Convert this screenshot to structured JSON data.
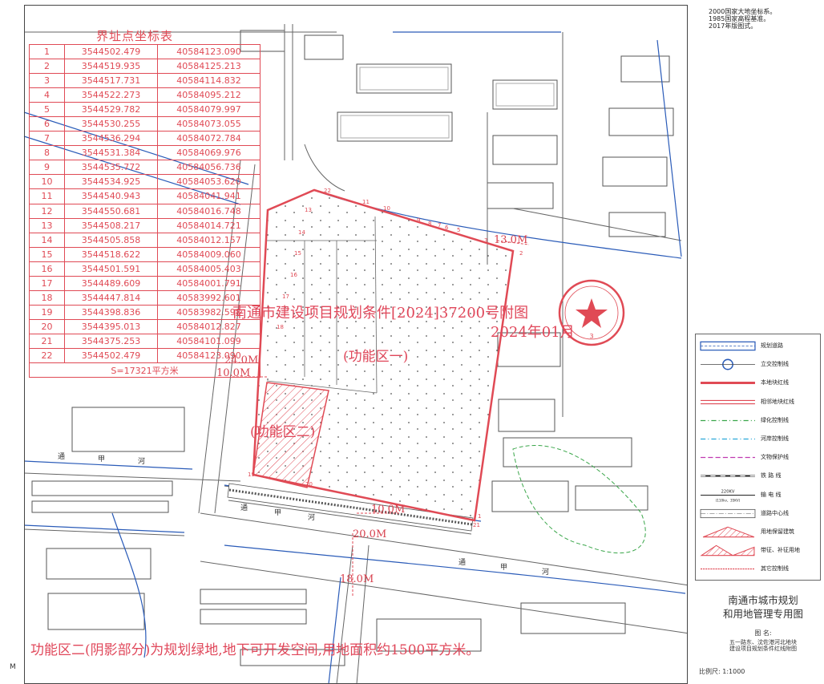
{
  "notes": [
    "2000国家大地坐标系。",
    "1985国家高程基准。",
    "2017年版图式。"
  ],
  "coord_table": {
    "title": "界址点坐标表",
    "rows": [
      [
        "1",
        "3544502.479",
        "40584123.090"
      ],
      [
        "2",
        "3544519.935",
        "40584125.213"
      ],
      [
        "3",
        "3544517.731",
        "40584114.832"
      ],
      [
        "4",
        "3544522.273",
        "40584095.212"
      ],
      [
        "5",
        "3544529.782",
        "40584079.997"
      ],
      [
        "6",
        "3544530.255",
        "40584073.055"
      ],
      [
        "7",
        "3544536.294",
        "40584072.784"
      ],
      [
        "8",
        "3544531.384",
        "40584069.976"
      ],
      [
        "9",
        "3544535.772",
        "40584056.736"
      ],
      [
        "10",
        "3544534.925",
        "40584053.620"
      ],
      [
        "11",
        "3544540.943",
        "40584041.941"
      ],
      [
        "12",
        "3544550.681",
        "40584016.748"
      ],
      [
        "13",
        "3544508.217",
        "40584014.721"
      ],
      [
        "14",
        "3544505.858",
        "40584012.157"
      ],
      [
        "15",
        "3544518.622",
        "40584009.060"
      ],
      [
        "16",
        "3544501.591",
        "40584005.403"
      ],
      [
        "17",
        "3544489.609",
        "40584001.791"
      ],
      [
        "18",
        "3544447.814",
        "40583992.601"
      ],
      [
        "19",
        "3544398.836",
        "40583982.598"
      ],
      [
        "20",
        "3544395.013",
        "40584012.827"
      ],
      [
        "21",
        "3544375.253",
        "40584101.099"
      ],
      [
        "22",
        "3544502.479",
        "40584123.090"
      ]
    ],
    "area": "S=17321平方米"
  },
  "annotations": {
    "main_title": "南通市建设项目规划条件[2024]37200号附图",
    "main_date": "2024年01月",
    "zone_one": "(功能区一)",
    "zone_two": "(功能区二)",
    "bottom_note": "功能区二(阴影部分)为规划绿地,地下可开发空间,用地面积约1500平方米。",
    "seal_number": "3"
  },
  "dimensions": [
    "13.0M",
    "24.0M",
    "10.0M",
    "10.0M",
    "20.0M",
    "18.0M"
  ],
  "parcel_points": [
    "11",
    "10",
    "9",
    "8",
    "7",
    "6",
    "5",
    "3",
    "2",
    "1",
    "13",
    "14",
    "15",
    "16",
    "17",
    "18",
    "19",
    "20",
    "21",
    "22"
  ],
  "road_labels": [
    "通",
    "甲",
    "河",
    "通",
    "甲",
    "河",
    "通",
    "甲",
    "河"
  ],
  "legend": [
    {
      "label": "规划道路",
      "symbol": "road"
    },
    {
      "label": "立交控制线",
      "symbol": "circle"
    },
    {
      "label": "本地块红线",
      "symbol": "red-thick"
    },
    {
      "label": "相邻地块红线",
      "symbol": "red-double"
    },
    {
      "label": "绿化控制线",
      "symbol": "green-dash"
    },
    {
      "label": "河岸控制线",
      "symbol": "cyan-dash"
    },
    {
      "label": "文物保护线",
      "symbol": "magenta-dash"
    },
    {
      "label": "铁 路 线",
      "symbol": "rail"
    },
    {
      "label": "输 电 线",
      "symbol": "power"
    },
    {
      "label": "道路中心线",
      "symbol": "center"
    },
    {
      "label": "用地保留建筑",
      "symbol": "hatch"
    },
    {
      "label": "带征、补征用地",
      "symbol": "hatch2"
    },
    {
      "label": "其它控制线",
      "symbol": "red-dot"
    }
  ],
  "power_label": "220KV",
  "power_sub": "(110kv、35KV)",
  "authority": [
    "南通市城市规划",
    "和用地管理专用图"
  ],
  "figure_label": "图 名:",
  "figure_name": [
    "五一路东、沈佐港河北地块",
    "建设项目规划条件红线附图"
  ],
  "scale": "比例尺: 1:1000",
  "side_mark": "M",
  "colors": {
    "red": "#e04a55",
    "blue": "#2a5bb8",
    "green": "#3aa64a",
    "line": "#444444"
  }
}
